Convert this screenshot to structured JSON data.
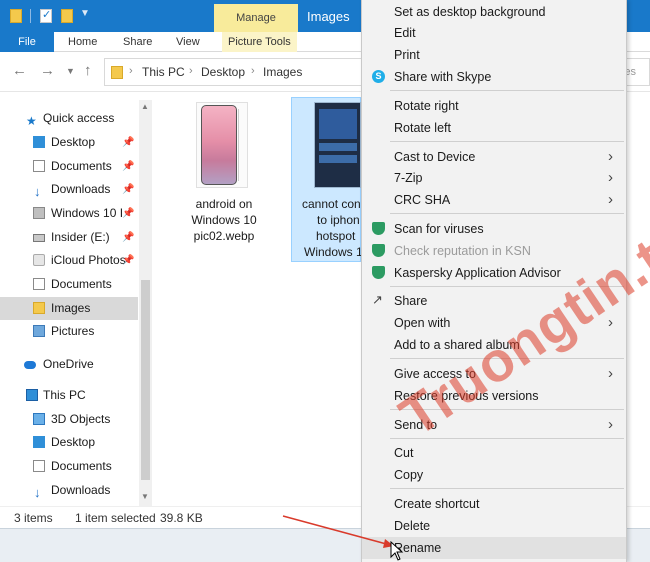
{
  "titlebar": {
    "manage_tab": "Manage",
    "window_title": "Images"
  },
  "ribbon": {
    "file": "File",
    "home": "Home",
    "share": "Share",
    "view": "View",
    "picture_tools": "Picture Tools"
  },
  "address": {
    "crumbs": [
      "This PC",
      "Desktop",
      "Images"
    ],
    "search_ghost": "es"
  },
  "sidebar": {
    "items": [
      {
        "label": "Quick access",
        "icon": "star-icon"
      },
      {
        "label": "Desktop",
        "icon": "desktop-icon",
        "pinned": true
      },
      {
        "label": "Documents",
        "icon": "documents-icon",
        "pinned": true
      },
      {
        "label": "Downloads",
        "icon": "downloads-icon",
        "pinned": true
      },
      {
        "label": "Windows 10 I",
        "icon": "windows-folder-icon",
        "pinned": true
      },
      {
        "label": "Insider (E:)",
        "icon": "drive-icon",
        "pinned": true
      },
      {
        "label": "iCloud Photos",
        "icon": "icloud-icon",
        "pinned": true
      },
      {
        "label": "Documents",
        "icon": "documents-icon"
      },
      {
        "label": "Images",
        "icon": "folder-icon"
      },
      {
        "label": "Pictures",
        "icon": "pictures-icon"
      },
      {
        "label": "OneDrive",
        "icon": "onedrive-icon"
      },
      {
        "label": "This PC",
        "icon": "pc-icon"
      },
      {
        "label": "3D Objects",
        "icon": "3d-objects-icon"
      },
      {
        "label": "Desktop",
        "icon": "desktop-icon"
      },
      {
        "label": "Documents",
        "icon": "documents-icon"
      },
      {
        "label": "Downloads",
        "icon": "downloads-icon"
      }
    ]
  },
  "files": [
    {
      "name_lines": [
        "android on",
        "Windows 10",
        "pic02.webp"
      ]
    },
    {
      "name_lines": [
        "cannot con",
        "to iphon",
        "hotspot",
        "Windows 1"
      ]
    }
  ],
  "status": {
    "items": "3 items",
    "selected": "1 item selected",
    "size": "39.8 KB"
  },
  "context_menu": {
    "set_desktop_bg": "Set as desktop background",
    "edit": "Edit",
    "print": "Print",
    "share_skype": "Share with Skype",
    "rotate_right": "Rotate right",
    "rotate_left": "Rotate left",
    "cast": "Cast to Device",
    "zip": "7-Zip",
    "crc": "CRC SHA",
    "scan": "Scan for viruses",
    "check_reputation": "Check reputation in KSN",
    "kaspersky_advisor": "Kaspersky Application Advisor",
    "share": "Share",
    "open_with": "Open with",
    "add_album": "Add to a shared album",
    "give_access": "Give access to",
    "restore": "Restore previous versions",
    "send_to": "Send to",
    "cut": "Cut",
    "copy": "Copy",
    "create_shortcut": "Create shortcut",
    "delete": "Delete",
    "rename": "Rename"
  },
  "watermark": "Truongtin.top",
  "colors": {
    "titlebar": "#1979ca",
    "manage_tab": "#f8eb9b",
    "selection": "#cce8ff",
    "menu_bg": "#f2f2f2",
    "watermark": "#dc3c28"
  }
}
